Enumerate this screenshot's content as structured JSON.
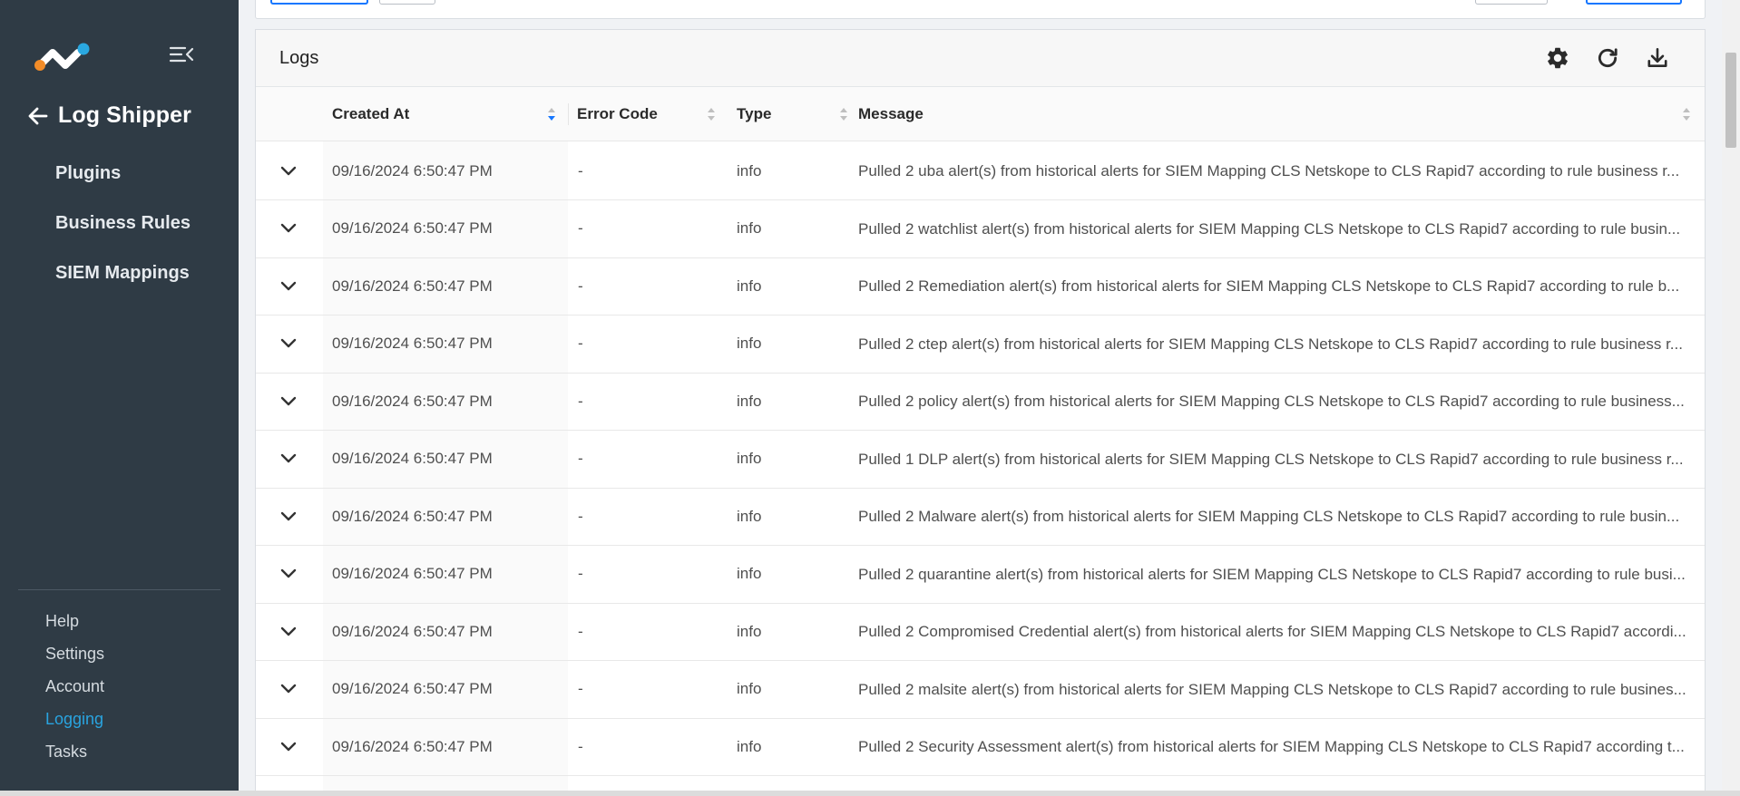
{
  "sidebar": {
    "back_title": "Log Shipper",
    "nav": [
      "Plugins",
      "Business Rules",
      "SIEM Mappings"
    ],
    "bottom": [
      "Help",
      "Settings",
      "Account",
      "Logging",
      "Tasks"
    ],
    "active_bottom": "Logging"
  },
  "logs": {
    "title": "Logs",
    "columns": [
      "Created At",
      "Error Code",
      "Type",
      "Message"
    ],
    "rows": [
      {
        "date": "09/16/2024 6:50:47 PM",
        "code": "-",
        "type": "info",
        "message": "Pulled 2 uba alert(s) from historical alerts for SIEM Mapping CLS Netskope to CLS Rapid7 according to rule business r..."
      },
      {
        "date": "09/16/2024 6:50:47 PM",
        "code": "-",
        "type": "info",
        "message": "Pulled 2 watchlist alert(s) from historical alerts for SIEM Mapping CLS Netskope to CLS Rapid7 according to rule busin..."
      },
      {
        "date": "09/16/2024 6:50:47 PM",
        "code": "-",
        "type": "info",
        "message": "Pulled 2 Remediation alert(s) from historical alerts for SIEM Mapping CLS Netskope to CLS Rapid7 according to rule b..."
      },
      {
        "date": "09/16/2024 6:50:47 PM",
        "code": "-",
        "type": "info",
        "message": "Pulled 2 ctep alert(s) from historical alerts for SIEM Mapping CLS Netskope to CLS Rapid7 according to rule business r..."
      },
      {
        "date": "09/16/2024 6:50:47 PM",
        "code": "-",
        "type": "info",
        "message": "Pulled 2 policy alert(s) from historical alerts for SIEM Mapping CLS Netskope to CLS Rapid7 according to rule business..."
      },
      {
        "date": "09/16/2024 6:50:47 PM",
        "code": "-",
        "type": "info",
        "message": "Pulled 1 DLP alert(s) from historical alerts for SIEM Mapping CLS Netskope to CLS Rapid7 according to rule business r..."
      },
      {
        "date": "09/16/2024 6:50:47 PM",
        "code": "-",
        "type": "info",
        "message": "Pulled 2 Malware alert(s) from historical alerts for SIEM Mapping CLS Netskope to CLS Rapid7 according to rule busin..."
      },
      {
        "date": "09/16/2024 6:50:47 PM",
        "code": "-",
        "type": "info",
        "message": "Pulled 2 quarantine alert(s) from historical alerts for SIEM Mapping CLS Netskope to CLS Rapid7 according to rule busi..."
      },
      {
        "date": "09/16/2024 6:50:47 PM",
        "code": "-",
        "type": "info",
        "message": "Pulled 2 Compromised Credential alert(s) from historical alerts for SIEM Mapping CLS Netskope to CLS Rapid7 accordi..."
      },
      {
        "date": "09/16/2024 6:50:47 PM",
        "code": "-",
        "type": "info",
        "message": "Pulled 2 malsite alert(s) from historical alerts for SIEM Mapping CLS Netskope to CLS Rapid7 according to rule busines..."
      },
      {
        "date": "09/16/2024 6:50:47 PM",
        "code": "-",
        "type": "info",
        "message": "Pulled 2 Security Assessment alert(s) from historical alerts for SIEM Mapping CLS Netskope to CLS Rapid7 according t..."
      }
    ]
  },
  "icons": {
    "header": [
      "gear-icon",
      "refresh-icon",
      "download-icon"
    ],
    "row_toggle": "chevron-down-icon",
    "back": "arrow-left-icon",
    "collapse": "menu-collapse-icon"
  },
  "colors": {
    "sidebar_bg": "#2f3b45",
    "active_link": "#29a4e0",
    "sort_active": "#1677ff"
  }
}
